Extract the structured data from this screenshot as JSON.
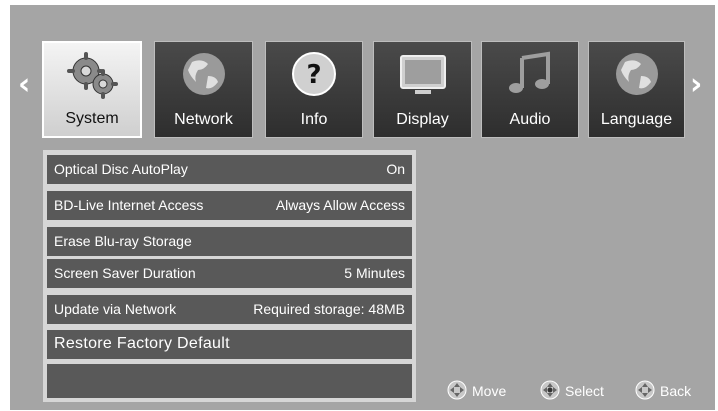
{
  "tabs": [
    {
      "label": "System",
      "icon": "gears-icon",
      "selected": true
    },
    {
      "label": "Network",
      "icon": "globe-icon",
      "selected": false
    },
    {
      "label": "Info",
      "icon": "question-icon",
      "selected": false
    },
    {
      "label": "Display",
      "icon": "monitor-icon",
      "selected": false
    },
    {
      "label": "Audio",
      "icon": "music-note-icon",
      "selected": false
    },
    {
      "label": "Language",
      "icon": "globe-icon",
      "selected": false
    }
  ],
  "nav": {
    "left": "‹",
    "right": "›"
  },
  "menu": [
    {
      "name": "Optical Disc AutoPlay",
      "value": "On"
    },
    {
      "name": "BD-Live Internet Access",
      "value": "Always Allow Access"
    },
    {
      "name": "Erase Blu-ray Storage",
      "value": ""
    },
    {
      "name": "Screen Saver Duration",
      "value": "5 Minutes"
    },
    {
      "name": "Update via Network",
      "value": "Required storage: 48MB"
    },
    {
      "name": "Restore Factory Default",
      "value": ""
    },
    {
      "name": "",
      "value": ""
    }
  ],
  "hints": {
    "move": "Move",
    "select": "Select",
    "back": "Back"
  }
}
